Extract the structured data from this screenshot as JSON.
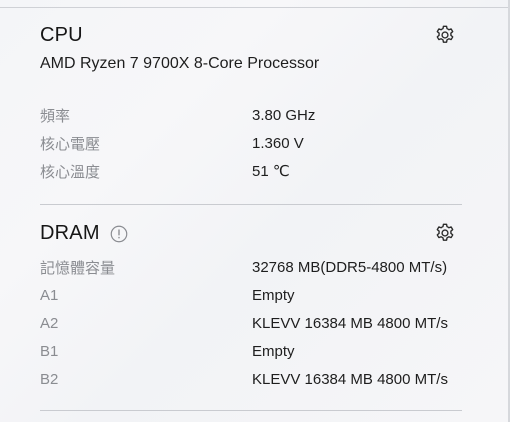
{
  "cpu": {
    "title": "CPU",
    "processor": "AMD Ryzen 7 9700X 8-Core Processor",
    "rows": [
      {
        "label": "頻率",
        "value": "3.80 GHz"
      },
      {
        "label": "核心電壓",
        "value": "1.360 V"
      },
      {
        "label": "核心溫度",
        "value": "51 ℃"
      }
    ]
  },
  "dram": {
    "title": "DRAM",
    "rows": [
      {
        "label": "記憶體容量",
        "value": "32768 MB(DDR5-4800 MT/s)"
      },
      {
        "label": "A1",
        "value": "Empty"
      },
      {
        "label": "A2",
        "value": "KLEVV 16384 MB 4800 MT/s"
      },
      {
        "label": "B1",
        "value": "Empty"
      },
      {
        "label": "B2",
        "value": "KLEVV 16384 MB 4800 MT/s"
      }
    ]
  },
  "icons": {
    "settings": "gear-icon",
    "info": "info-icon"
  }
}
